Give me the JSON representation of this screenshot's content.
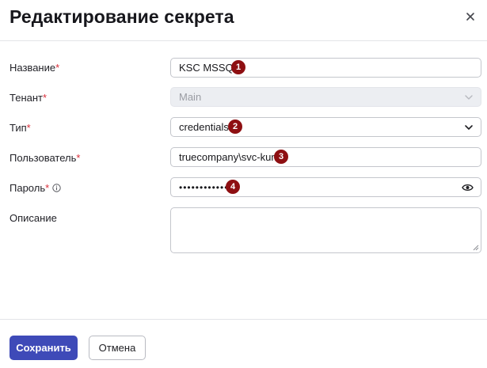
{
  "dialog": {
    "title": "Редактирование секрета",
    "close_icon": "close-icon"
  },
  "form": {
    "name": {
      "label": "Название",
      "required_mark": "*",
      "value": "KSC MSSQL",
      "badge": "1"
    },
    "tenant": {
      "label": "Тенант",
      "required_mark": "*",
      "value": "Main",
      "disabled": true
    },
    "type": {
      "label": "Тип",
      "required_mark": "*",
      "value": "credentials",
      "badge": "2"
    },
    "user": {
      "label": "Пользователь",
      "required_mark": "*",
      "value": "truecompany\\svc-kuma",
      "badge": "3"
    },
    "password": {
      "label": "Пароль",
      "required_mark": "*",
      "value": "••••••••••••",
      "badge": "4",
      "info_icon": "info-icon",
      "reveal_icon": "eye-icon"
    },
    "description": {
      "label": "Описание",
      "value": ""
    }
  },
  "footer": {
    "save_label": "Сохранить",
    "cancel_label": "Отмена"
  },
  "colors": {
    "primary": "#3e4ab8",
    "badge": "#8e0f12",
    "required": "#d92e3a",
    "disabled_bg": "#eceef2"
  }
}
